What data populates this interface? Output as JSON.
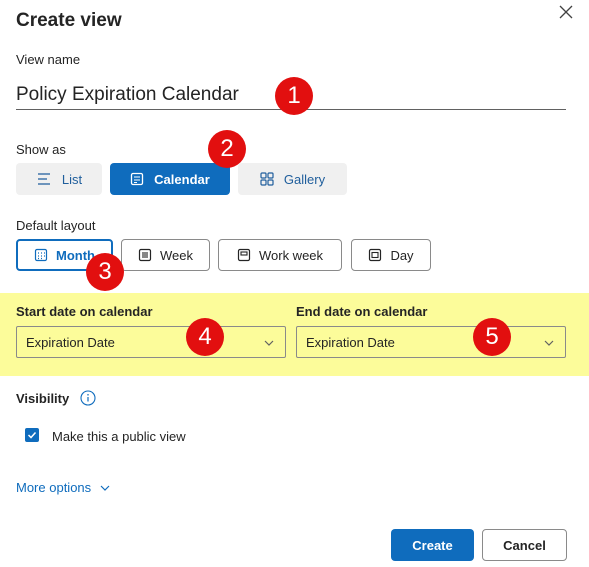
{
  "dialog": {
    "title": "Create view",
    "close_icon": "close-icon"
  },
  "view_name": {
    "label": "View name",
    "value": "Policy Expiration Calendar"
  },
  "show_as": {
    "label": "Show as",
    "options": [
      {
        "label": "List",
        "icon": "list-icon",
        "selected": false
      },
      {
        "label": "Calendar",
        "icon": "calendar-icon",
        "selected": true
      },
      {
        "label": "Gallery",
        "icon": "gallery-icon",
        "selected": false
      }
    ]
  },
  "default_layout": {
    "label": "Default layout",
    "options": [
      {
        "label": "Month",
        "icon": "month-icon",
        "selected": true
      },
      {
        "label": "Week",
        "icon": "week-icon",
        "selected": false
      },
      {
        "label": "Work week",
        "icon": "work-week-icon",
        "selected": false
      },
      {
        "label": "Day",
        "icon": "day-icon",
        "selected": false
      }
    ]
  },
  "start_date": {
    "label": "Start date on calendar",
    "value": "Expiration Date"
  },
  "end_date": {
    "label": "End date on calendar",
    "value": "Expiration Date"
  },
  "visibility": {
    "label": "Visibility",
    "info_icon": "info-icon",
    "public_label": "Make this a public view",
    "public_checked": true
  },
  "more_options": {
    "label": "More options"
  },
  "footer": {
    "create_label": "Create",
    "cancel_label": "Cancel"
  },
  "callouts": [
    "1",
    "2",
    "3",
    "4",
    "5"
  ],
  "colors": {
    "accent": "#0f6cbd",
    "highlight": "#fcfc9a",
    "callout": "#e20f0f"
  }
}
